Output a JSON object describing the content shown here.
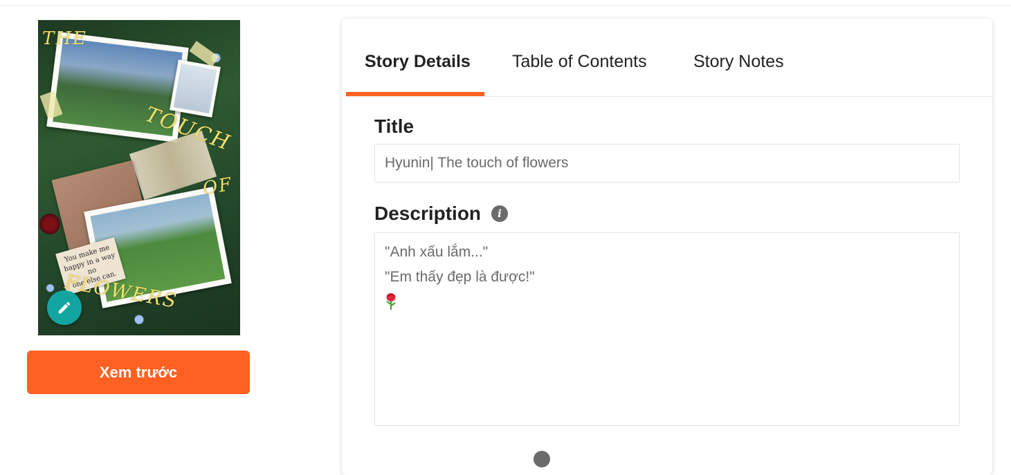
{
  "cover": {
    "words": [
      "THE",
      "TOUCH",
      "OF",
      "FLOWERS"
    ],
    "note_text": [
      "You make me",
      "happy in a way no",
      "one else can."
    ],
    "edit_icon": "pencil-icon"
  },
  "actions": {
    "preview_label": "Xem trước"
  },
  "tabs": [
    {
      "label": "Story Details",
      "active": true
    },
    {
      "label": "Table of Contents",
      "active": false
    },
    {
      "label": "Story Notes",
      "active": false
    }
  ],
  "form": {
    "title_label": "Title",
    "title_value": "Hyunin| The touch of flowers",
    "description_label": "Description",
    "description_lines": [
      "\"Anh xấu lắm...\"",
      "\"Em thấy đẹp là được!\""
    ],
    "description_emoji": "rose-emoji",
    "info_icon": "info-icon"
  },
  "colors": {
    "accent": "#ff6122",
    "fab": "#12a5a0",
    "text": "#222222",
    "muted_text": "#6a6a6a"
  }
}
